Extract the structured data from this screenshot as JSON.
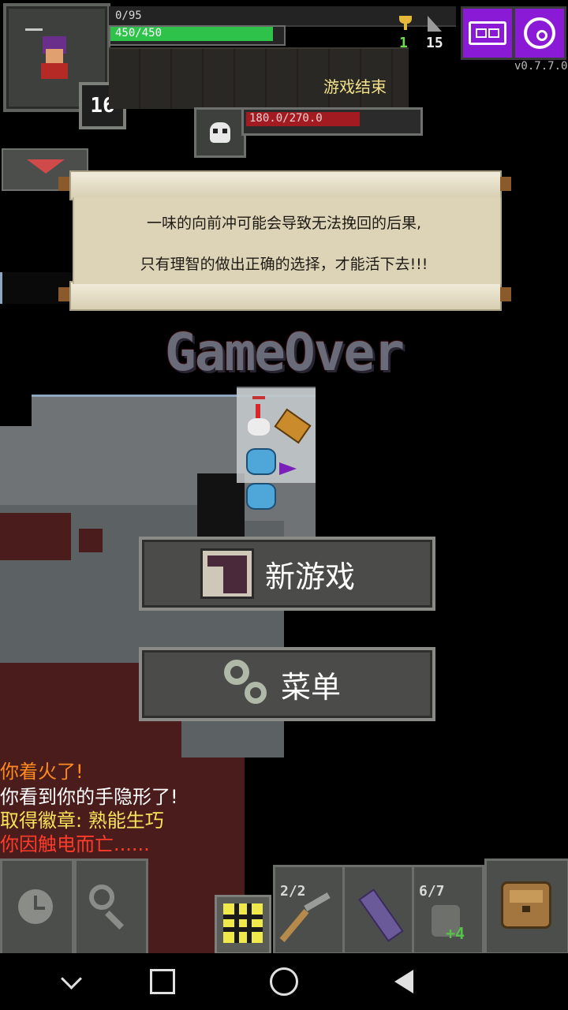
{
  "hud": {
    "exp": "0/95",
    "hp": "450/450",
    "hp_fraction": 1.0,
    "level": "16",
    "gold": "1",
    "depth": "15",
    "version": "v0.7.7.0",
    "status": "游戏结束"
  },
  "boss": {
    "hp": "180.0/270.0",
    "hp_fraction": 0.667
  },
  "scroll": {
    "line1": "一味的向前冲可能会导致无法挽回的后果,",
    "line2": "只有理智的做出正确的选择，才能活下去!!!"
  },
  "gameover": {
    "title": "GameOver"
  },
  "buttons": {
    "new_game": "新游戏",
    "menu": "菜单"
  },
  "log": [
    {
      "text": "你着火了!",
      "color": "#ff8a1f"
    },
    {
      "text": "你看到你的手隐形了!",
      "color": "#ffffff"
    },
    {
      "text": "取得徽章: 熟能生巧",
      "color": "#f5e45a"
    },
    {
      "text": "你因触电而亡......",
      "color": "#ff3b2a"
    }
  ],
  "quickslots": {
    "slot1_count": "2/2",
    "slot3_count": "6/7",
    "slot3_extra": "+4"
  },
  "icons": {
    "journal": "journal-icon",
    "settings": "settings-icon",
    "wait": "clock-icon",
    "search": "search-icon",
    "backpack": "backpack-icon"
  }
}
